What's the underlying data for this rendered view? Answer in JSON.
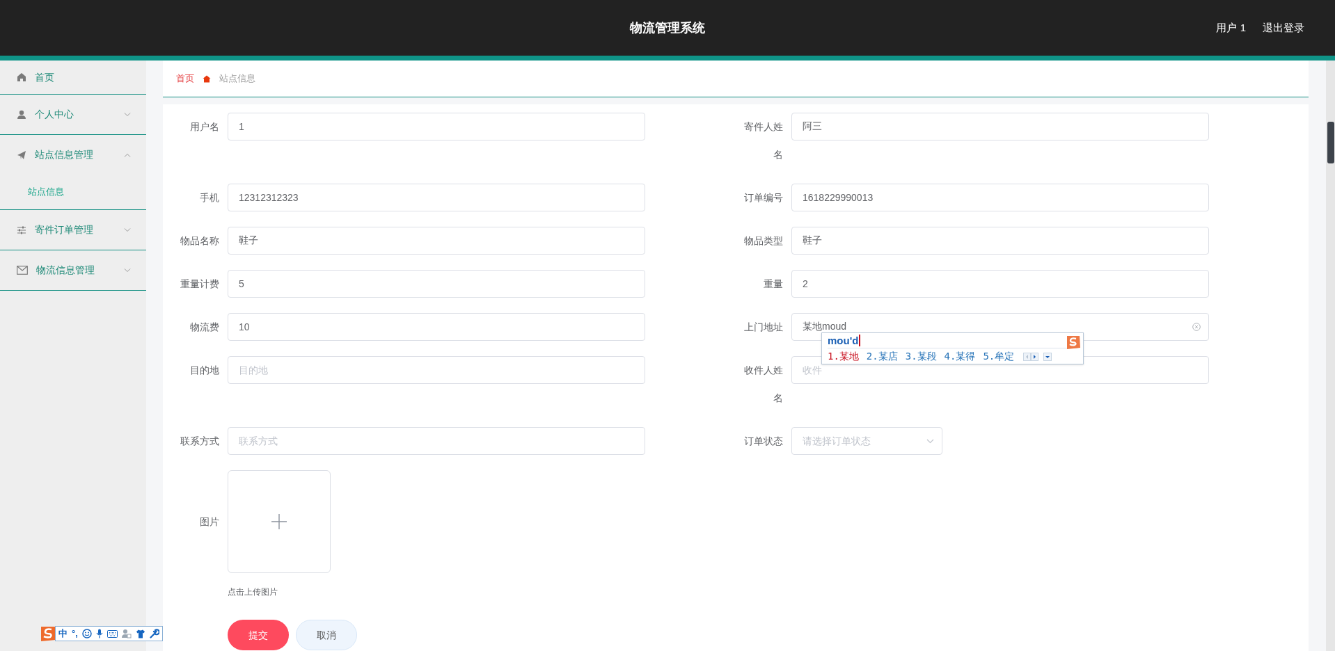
{
  "header": {
    "title": "物流管理系统",
    "user": "用户 1",
    "logout": "退出登录"
  },
  "sidebar": {
    "items": [
      {
        "label": "首页"
      },
      {
        "label": "个人中心",
        "expanded": false
      },
      {
        "label": "站点信息管理",
        "expanded": true,
        "children": [
          {
            "label": "站点信息"
          }
        ]
      },
      {
        "label": "寄件订单管理",
        "expanded": false
      },
      {
        "label": "物流信息管理",
        "expanded": false
      }
    ]
  },
  "breadcrumb": [
    "首页",
    "站点信息"
  ],
  "form": {
    "rows": [
      [
        {
          "kind": "input",
          "label": "用户名",
          "value": "1",
          "clearable": false
        },
        {
          "kind": "input",
          "label": "寄件人姓名",
          "value": "阿三",
          "clearable": false
        }
      ],
      [
        {
          "kind": "input",
          "label": "手机",
          "value": "12312312323",
          "clearable": false
        },
        {
          "kind": "input",
          "label": "订单编号",
          "value": "1618229990013",
          "clearable": false
        }
      ],
      [
        {
          "kind": "input",
          "label": "物品名称",
          "value": "鞋子",
          "clearable": false
        },
        {
          "kind": "input",
          "label": "物品类型",
          "value": "鞋子",
          "clearable": false
        }
      ],
      [
        {
          "kind": "input",
          "label": "重量计费",
          "value": "5",
          "clearable": false
        },
        {
          "kind": "input",
          "label": "重量",
          "value": "2",
          "clearable": false
        }
      ],
      [
        {
          "kind": "input",
          "label": "物流费",
          "value": "10",
          "clearable": false
        },
        {
          "kind": "input",
          "label": "上门地址",
          "value": "某地moud",
          "clearable": true
        }
      ],
      [
        {
          "kind": "input",
          "label": "目的地",
          "placeholder": "目的地",
          "clearable": false
        },
        {
          "kind": "input",
          "label": "收件人姓名",
          "placeholder": "收件",
          "clearable": false
        }
      ],
      [
        {
          "kind": "input",
          "label": "联系方式",
          "placeholder": "联系方式",
          "clearable": false
        },
        {
          "kind": "select",
          "label": "订单状态",
          "placeholder": "请选择订单状态"
        }
      ],
      [
        {
          "kind": "upload",
          "label": "图片",
          "hint": "点击上传图片"
        }
      ]
    ],
    "buttons": [
      {
        "kind": "primary",
        "label": "提交"
      },
      {
        "kind": "default",
        "label": "取消"
      }
    ]
  },
  "ime_popup": {
    "composition": "mou'd",
    "candidates": [
      {
        "text": "1.某地",
        "selected": true
      },
      {
        "text": "2.某店",
        "selected": false
      },
      {
        "text": "3.某段",
        "selected": false
      },
      {
        "text": "4.某得",
        "selected": false
      },
      {
        "text": "5.牟定",
        "selected": false
      }
    ]
  },
  "ime_toolbar": {
    "mode": "中",
    "punctuation": "°,"
  }
}
